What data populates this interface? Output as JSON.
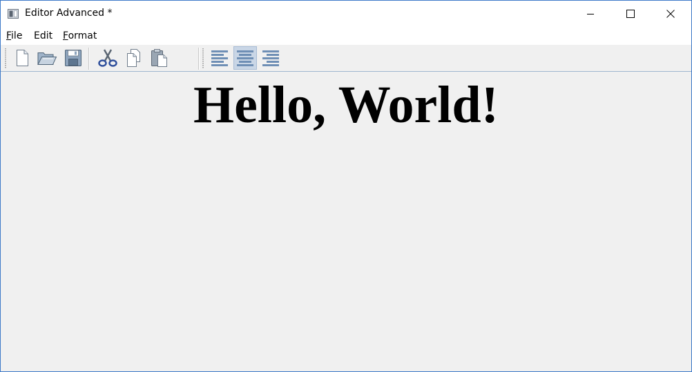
{
  "window": {
    "title": "Editor Advanced *"
  },
  "menu": [
    {
      "mnemonic": "F",
      "rest": "ile"
    },
    {
      "mnemonic": "",
      "rest": "Edit"
    },
    {
      "mnemonic": "F",
      "rest": "ormat"
    }
  ],
  "toolbar": {
    "file_group": [
      "new-icon",
      "open-icon",
      "save-icon"
    ],
    "edit_group": [
      "cut-icon",
      "copy-icon",
      "paste-icon"
    ],
    "align_group": [
      "align-left-icon",
      "align-center-icon",
      "align-right-icon"
    ],
    "active_alignment": "center"
  },
  "document": {
    "text": "Hello, World!"
  },
  "colors": {
    "window_border": "#3c78c8",
    "background": "#f0f0f0",
    "pressed": "#c9d6e6",
    "icon_blue": "#6f8fb5"
  }
}
